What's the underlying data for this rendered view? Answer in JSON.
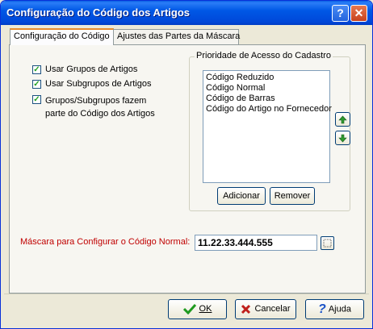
{
  "window": {
    "title": "Configuração do Código dos Artigos"
  },
  "titlebar": {
    "help_icon": "?",
    "close_icon": "✕"
  },
  "tabs": [
    {
      "label": "Configuração do Código"
    },
    {
      "label": "Ajustes das Partes da Máscara"
    }
  ],
  "options": {
    "use_groups": {
      "label": "Usar Grupos de Artigos",
      "checked": true
    },
    "use_subgroups": {
      "label": "Usar Subgrupos de Artigos",
      "checked": true
    },
    "groups_in_code": {
      "label_line1": "Grupos/Subgrupos fazem",
      "label_line2": "parte do Código dos Artigos",
      "checked": true
    }
  },
  "priority": {
    "label": "Prioridade de Acesso do Cadastro",
    "items": [
      "Código Reduzido",
      "Código Normal",
      "Código de Barras",
      "Código do Artigo no Fornecedor"
    ],
    "add_label": "Adicionar",
    "remove_label": "Remover"
  },
  "mask": {
    "label": "Máscara para Configurar o Código Normal:",
    "value": "11.22.33.444.555"
  },
  "footer": {
    "ok_label": "OK",
    "cancel_label": "Cancelar",
    "help_label": "Ajuda"
  },
  "colors": {
    "title_bar": "#0054e3",
    "mask_label": "#c00000",
    "ok_icon": "#1f9a1f",
    "cancel_icon": "#c0201c",
    "help_icon": "#1c54c8",
    "arrow_icon": "#2f9a2f"
  },
  "icons": [
    "help-icon",
    "close-icon",
    "check-icon",
    "arrow-up-icon",
    "arrow-down-icon",
    "ok-check-icon",
    "cancel-x-icon",
    "help-question-icon"
  ]
}
